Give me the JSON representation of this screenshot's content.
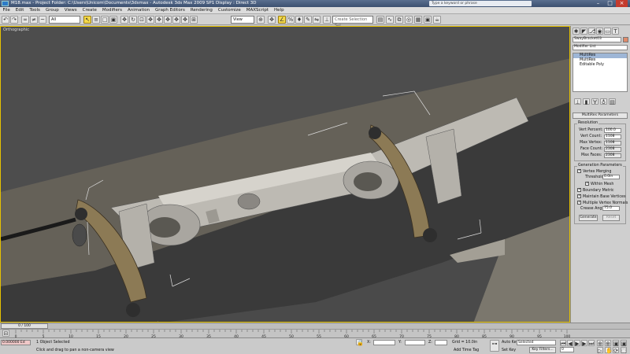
{
  "titlebar": {
    "title": "M18.max   - Project Folder: C:\\Users\\Unicom\\Documents\\3dsmax   - Autodesk 3ds Max 2009 SP1   Display : Direct 3D",
    "search_placeholder": "Type a keyword or phrase",
    "minimize": "–",
    "maximize": "□",
    "close": "×"
  },
  "menu": [
    "File",
    "Edit",
    "Tools",
    "Group",
    "Views",
    "Create",
    "Modifiers",
    "Animation",
    "Graph Editors",
    "Rendering",
    "Customize",
    "MAXScript",
    "Help"
  ],
  "toolbar": {
    "filter_value": "All",
    "coord_value": "View",
    "selection_set_placeholder": "Create Selection Set"
  },
  "viewport": {
    "label": "Orthographic"
  },
  "command_panel": {
    "object_name": "SwayBracket03",
    "modifier_list": "Modifier List",
    "stack": [
      "MultiRes",
      "MultiRes",
      "Editable Poly"
    ],
    "rollout_title": "MultiRes Parameters",
    "resolution_label": "Resolution",
    "vert_percent_label": "Vert Percent:",
    "vert_percent": "100.0",
    "vert_count_label": "Vert Count:",
    "vert_count": "1108",
    "max_vertex_label": "Max Vertex:",
    "max_vertex": "1108",
    "face_count_label": "Face Count:",
    "face_count": "2308",
    "max_faces_label": "Max Faces:",
    "max_faces": "2308",
    "gen_params_label": "Generation Parameters",
    "vertex_merging": "Vertex Merging",
    "threshold_label": "Threshold",
    "threshold": "0.0in",
    "within_mesh": "Within Mesh",
    "boundary_metric": "Boundary Metric",
    "maintain_base": "Maintain Base Vertices",
    "multiple_normals": "Multiple Vertex Normals",
    "crease_label": "Crease Angle",
    "crease": "75.0",
    "generate": "Generate",
    "reset": "Reset"
  },
  "timeline": {
    "frame_counter": "0 / 100",
    "ticks": [
      "0",
      "5",
      "10",
      "15",
      "20",
      "25",
      "30",
      "35",
      "40",
      "45",
      "50",
      "55",
      "60",
      "65",
      "70",
      "75",
      "80",
      "85",
      "90",
      "95",
      "100"
    ]
  },
  "status": {
    "maxscript_value": "0.000000  Ed",
    "selected": "1 Object Selected",
    "prompt": "Click and drag to pan a non-camera view",
    "x_label": "X:",
    "y_label": "Y:",
    "z_label": "Z:",
    "grid": "Grid = 10.0in",
    "add_time_tag": "Add Time Tag",
    "auto_key": "Auto Key",
    "set_key": "Set Key",
    "key_filters": "Key Filters...",
    "selected_dropdown": "Selected",
    "frame": "0"
  },
  "colors": {
    "viewport_bg": "#4a4a4a",
    "active_border": "#e6c200",
    "object_wrap": "#e08a6a",
    "model_light": "#c9c6bf",
    "arm_tan": "#8c7a55"
  }
}
